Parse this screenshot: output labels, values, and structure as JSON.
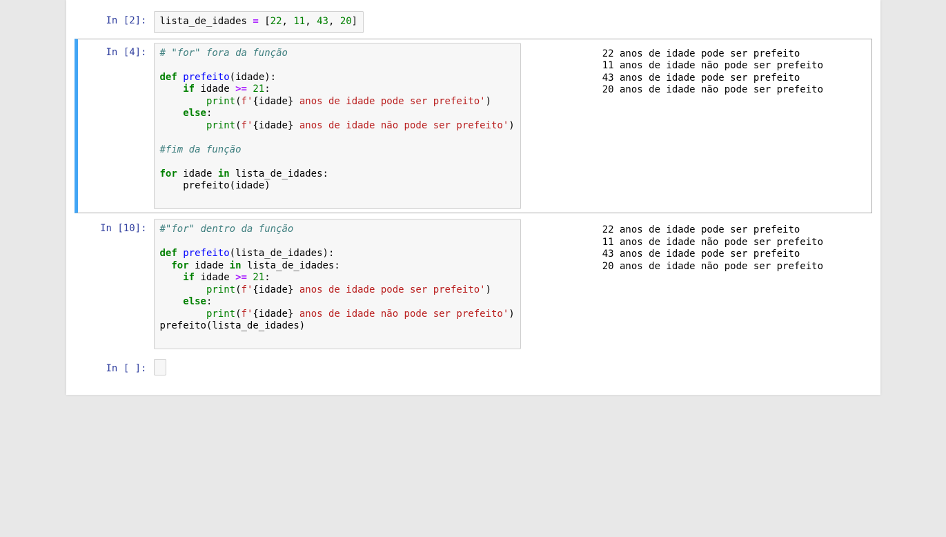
{
  "cells": [
    {
      "prompt": "In [2]:",
      "selected": false,
      "codeLines": [
        [
          {
            "t": "lista_de_idades ",
            "c": "c-name"
          },
          {
            "t": "=",
            "c": "c-op"
          },
          {
            "t": " [",
            "c": "c-punct"
          },
          {
            "t": "22",
            "c": "c-num"
          },
          {
            "t": ", ",
            "c": "c-punct"
          },
          {
            "t": "11",
            "c": "c-num"
          },
          {
            "t": ", ",
            "c": "c-punct"
          },
          {
            "t": "43",
            "c": "c-num"
          },
          {
            "t": ", ",
            "c": "c-punct"
          },
          {
            "t": "20",
            "c": "c-num"
          },
          {
            "t": "]",
            "c": "c-punct"
          }
        ]
      ],
      "output": null
    },
    {
      "prompt": "In [4]:",
      "selected": true,
      "codeLines": [
        [
          {
            "t": "# \"for\" fora da função",
            "c": "c-comment"
          }
        ],
        [],
        [
          {
            "t": "def",
            "c": "c-keyword"
          },
          {
            "t": " ",
            "c": "c-punct"
          },
          {
            "t": "prefeito",
            "c": "c-def"
          },
          {
            "t": "(idade):",
            "c": "c-punct"
          }
        ],
        [
          {
            "t": "    ",
            "c": "c-punct"
          },
          {
            "t": "if",
            "c": "c-keyword"
          },
          {
            "t": " idade ",
            "c": "c-name"
          },
          {
            "t": ">=",
            "c": "c-op"
          },
          {
            "t": " ",
            "c": "c-punct"
          },
          {
            "t": "21",
            "c": "c-num"
          },
          {
            "t": ":",
            "c": "c-punct"
          }
        ],
        [
          {
            "t": "        ",
            "c": "c-punct"
          },
          {
            "t": "print",
            "c": "c-builtin"
          },
          {
            "t": "(",
            "c": "c-punct"
          },
          {
            "t": "f'",
            "c": "c-str"
          },
          {
            "t": "{idade}",
            "c": "c-var"
          },
          {
            "t": " anos de idade pode ser prefeito'",
            "c": "c-str"
          },
          {
            "t": ")",
            "c": "c-punct"
          }
        ],
        [
          {
            "t": "    ",
            "c": "c-punct"
          },
          {
            "t": "else",
            "c": "c-keyword"
          },
          {
            "t": ":",
            "c": "c-punct"
          }
        ],
        [
          {
            "t": "        ",
            "c": "c-punct"
          },
          {
            "t": "print",
            "c": "c-builtin"
          },
          {
            "t": "(",
            "c": "c-punct"
          },
          {
            "t": "f'",
            "c": "c-str"
          },
          {
            "t": "{idade}",
            "c": "c-var"
          },
          {
            "t": " anos de idade não pode ser prefeito'",
            "c": "c-str"
          },
          {
            "t": ")",
            "c": "c-punct"
          }
        ],
        [],
        [
          {
            "t": "#fim da função",
            "c": "c-comment"
          }
        ],
        [],
        [
          {
            "t": "for",
            "c": "c-keyword"
          },
          {
            "t": " idade ",
            "c": "c-name"
          },
          {
            "t": "in",
            "c": "c-keyword"
          },
          {
            "t": " lista_de_idades:",
            "c": "c-name"
          }
        ],
        [
          {
            "t": "    prefeito(idade)",
            "c": "c-name"
          }
        ],
        [],
        []
      ],
      "output": "22 anos de idade pode ser prefeito\n11 anos de idade não pode ser prefeito\n43 anos de idade pode ser prefeito\n20 anos de idade não pode ser prefeito"
    },
    {
      "prompt": "In [10]:",
      "selected": false,
      "codeLines": [
        [
          {
            "t": "#\"for\" dentro da função",
            "c": "c-comment"
          }
        ],
        [],
        [
          {
            "t": "def",
            "c": "c-keyword"
          },
          {
            "t": " ",
            "c": "c-punct"
          },
          {
            "t": "prefeito",
            "c": "c-def"
          },
          {
            "t": "(lista_de_idades):",
            "c": "c-punct"
          }
        ],
        [
          {
            "t": "  ",
            "c": "c-punct"
          },
          {
            "t": "for",
            "c": "c-keyword"
          },
          {
            "t": " idade ",
            "c": "c-name"
          },
          {
            "t": "in",
            "c": "c-keyword"
          },
          {
            "t": " lista_de_idades:",
            "c": "c-name"
          }
        ],
        [
          {
            "t": "    ",
            "c": "c-punct"
          },
          {
            "t": "if",
            "c": "c-keyword"
          },
          {
            "t": " idade ",
            "c": "c-name"
          },
          {
            "t": ">=",
            "c": "c-op"
          },
          {
            "t": " ",
            "c": "c-punct"
          },
          {
            "t": "21",
            "c": "c-num"
          },
          {
            "t": ":",
            "c": "c-punct"
          }
        ],
        [
          {
            "t": "        ",
            "c": "c-punct"
          },
          {
            "t": "print",
            "c": "c-builtin"
          },
          {
            "t": "(",
            "c": "c-punct"
          },
          {
            "t": "f'",
            "c": "c-str"
          },
          {
            "t": "{idade}",
            "c": "c-var"
          },
          {
            "t": " anos de idade pode ser prefeito'",
            "c": "c-str"
          },
          {
            "t": ")",
            "c": "c-punct"
          }
        ],
        [
          {
            "t": "    ",
            "c": "c-punct"
          },
          {
            "t": "else",
            "c": "c-keyword"
          },
          {
            "t": ":",
            "c": "c-punct"
          }
        ],
        [
          {
            "t": "        ",
            "c": "c-punct"
          },
          {
            "t": "print",
            "c": "c-builtin"
          },
          {
            "t": "(",
            "c": "c-punct"
          },
          {
            "t": "f'",
            "c": "c-str"
          },
          {
            "t": "{idade}",
            "c": "c-var"
          },
          {
            "t": " anos de idade não pode ser prefeito'",
            "c": "c-str"
          },
          {
            "t": ")",
            "c": "c-punct"
          }
        ],
        [
          {
            "t": "prefeito(lista_de_idades)",
            "c": "c-name"
          }
        ],
        [],
        []
      ],
      "output": "22 anos de idade pode ser prefeito\n11 anos de idade não pode ser prefeito\n43 anos de idade pode ser prefeito\n20 anos de idade não pode ser prefeito"
    },
    {
      "prompt": "In [ ]:",
      "selected": false,
      "codeLines": [
        []
      ],
      "output": null,
      "empty": true
    }
  ]
}
